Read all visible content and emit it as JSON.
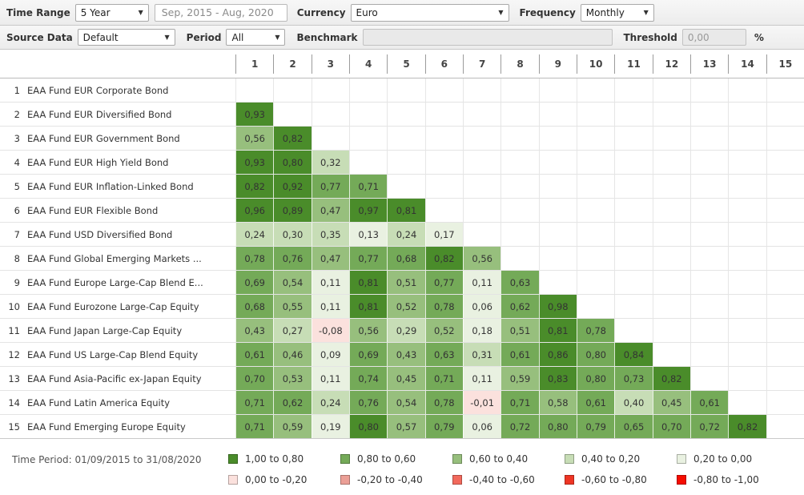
{
  "toolbar": {
    "time_range_label": "Time Range",
    "time_range_value": "5 Year",
    "date_range": "Sep, 2015 - Aug, 2020",
    "currency_label": "Currency",
    "currency_value": "Euro",
    "frequency_label": "Frequency",
    "frequency_value": "Monthly",
    "source_data_label": "Source Data",
    "source_data_value": "Default",
    "period_label": "Period",
    "period_value": "All",
    "benchmark_label": "Benchmark",
    "benchmark_value": "",
    "threshold_label": "Threshold",
    "threshold_value": "0,00",
    "threshold_unit": "%",
    "dropdown_caret": "▼"
  },
  "colors": {
    "a": "#4a8c2a",
    "b": "#74aa58",
    "c": "#97bf7d",
    "d": "#c7ddb6",
    "e": "#e9f1e1",
    "f": "#fbe1dd",
    "g": "#eb9f96",
    "h": "#f2695c",
    "i": "#ee3524",
    "j": "#f50d00"
  },
  "matrix": {
    "columns": [
      "1",
      "2",
      "3",
      "4",
      "5",
      "6",
      "7",
      "8",
      "9",
      "10",
      "11",
      "12",
      "13",
      "14",
      "15"
    ],
    "rows": [
      {
        "num": "1",
        "label": "EAA Fund EUR Corporate Bond",
        "values": [],
        "levels": []
      },
      {
        "num": "2",
        "label": "EAA Fund EUR Diversified Bond",
        "values": [
          "0,93"
        ],
        "levels": [
          "a"
        ]
      },
      {
        "num": "3",
        "label": "EAA Fund EUR Government Bond",
        "values": [
          "0,56",
          "0,82"
        ],
        "levels": [
          "c",
          "a"
        ]
      },
      {
        "num": "4",
        "label": "EAA Fund EUR High Yield Bond",
        "values": [
          "0,93",
          "0,80",
          "0,32"
        ],
        "levels": [
          "a",
          "a",
          "d"
        ]
      },
      {
        "num": "5",
        "label": "EAA Fund EUR Inflation-Linked Bond",
        "values": [
          "0,82",
          "0,92",
          "0,77",
          "0,71"
        ],
        "levels": [
          "a",
          "a",
          "b",
          "b"
        ]
      },
      {
        "num": "6",
        "label": "EAA Fund EUR Flexible Bond",
        "values": [
          "0,96",
          "0,89",
          "0,47",
          "0,97",
          "0,81"
        ],
        "levels": [
          "a",
          "a",
          "c",
          "a",
          "a"
        ]
      },
      {
        "num": "7",
        "label": "EAA Fund USD Diversified Bond",
        "values": [
          "0,24",
          "0,30",
          "0,35",
          "0,13",
          "0,24",
          "0,17"
        ],
        "levels": [
          "d",
          "d",
          "d",
          "e",
          "d",
          "e"
        ]
      },
      {
        "num": "8",
        "label": "EAA Fund Global Emerging Markets ...",
        "values": [
          "0,78",
          "0,76",
          "0,47",
          "0,77",
          "0,68",
          "0,82",
          "0,56"
        ],
        "levels": [
          "b",
          "b",
          "c",
          "b",
          "b",
          "a",
          "c"
        ]
      },
      {
        "num": "9",
        "label": "EAA Fund Europe Large-Cap Blend E...",
        "values": [
          "0,69",
          "0,54",
          "0,11",
          "0,81",
          "0,51",
          "0,77",
          "0,11",
          "0,63"
        ],
        "levels": [
          "b",
          "c",
          "e",
          "a",
          "c",
          "b",
          "e",
          "b"
        ]
      },
      {
        "num": "10",
        "label": "EAA Fund Eurozone Large-Cap Equity",
        "values": [
          "0,68",
          "0,55",
          "0,11",
          "0,81",
          "0,52",
          "0,78",
          "0,06",
          "0,62",
          "0,98"
        ],
        "levels": [
          "b",
          "c",
          "e",
          "a",
          "c",
          "b",
          "e",
          "b",
          "a"
        ]
      },
      {
        "num": "11",
        "label": "EAA Fund Japan Large-Cap Equity",
        "values": [
          "0,43",
          "0,27",
          "-0,08",
          "0,56",
          "0,29",
          "0,52",
          "0,18",
          "0,51",
          "0,81",
          "0,78"
        ],
        "levels": [
          "c",
          "d",
          "f",
          "c",
          "d",
          "c",
          "e",
          "c",
          "a",
          "b"
        ]
      },
      {
        "num": "12",
        "label": "EAA Fund US Large-Cap Blend Equity",
        "values": [
          "0,61",
          "0,46",
          "0,09",
          "0,69",
          "0,43",
          "0,63",
          "0,31",
          "0,61",
          "0,86",
          "0,80",
          "0,84"
        ],
        "levels": [
          "b",
          "c",
          "e",
          "b",
          "c",
          "b",
          "d",
          "b",
          "a",
          "b",
          "a"
        ]
      },
      {
        "num": "13",
        "label": "EAA Fund Asia-Pacific ex-Japan Equity",
        "values": [
          "0,70",
          "0,53",
          "0,11",
          "0,74",
          "0,45",
          "0,71",
          "0,11",
          "0,59",
          "0,83",
          "0,80",
          "0,73",
          "0,82"
        ],
        "levels": [
          "b",
          "c",
          "e",
          "b",
          "c",
          "b",
          "e",
          "c",
          "a",
          "b",
          "b",
          "a"
        ]
      },
      {
        "num": "14",
        "label": "EAA Fund Latin America Equity",
        "values": [
          "0,71",
          "0,62",
          "0,24",
          "0,76",
          "0,54",
          "0,78",
          "-0,01",
          "0,71",
          "0,58",
          "0,61",
          "0,40",
          "0,45",
          "0,61"
        ],
        "levels": [
          "b",
          "b",
          "d",
          "b",
          "c",
          "b",
          "f",
          "b",
          "c",
          "b",
          "d",
          "c",
          "b"
        ]
      },
      {
        "num": "15",
        "label": "EAA Fund Emerging Europe Equity",
        "values": [
          "0,71",
          "0,59",
          "0,19",
          "0,80",
          "0,57",
          "0,79",
          "0,06",
          "0,72",
          "0,80",
          "0,79",
          "0,65",
          "0,70",
          "0,72",
          "0,82"
        ],
        "levels": [
          "b",
          "c",
          "e",
          "a",
          "c",
          "b",
          "e",
          "b",
          "b",
          "b",
          "b",
          "b",
          "b",
          "a"
        ]
      }
    ]
  },
  "legend": {
    "time_period": "Time Period: 01/09/2015 to 31/08/2020",
    "items": [
      {
        "label": "1,00 to 0,80",
        "level": "a"
      },
      {
        "label": "0,80 to 0,60",
        "level": "b"
      },
      {
        "label": "0,60 to 0,40",
        "level": "c"
      },
      {
        "label": "0,40 to 0,20",
        "level": "d"
      },
      {
        "label": "0,20 to 0,00",
        "level": "e"
      },
      {
        "label": "0,00 to -0,20",
        "level": "f"
      },
      {
        "label": "-0,20 to -0,40",
        "level": "g"
      },
      {
        "label": "-0,40 to -0,60",
        "level": "h"
      },
      {
        "label": "-0,60 to -0,80",
        "level": "i"
      },
      {
        "label": "-0,80 to -1,00",
        "level": "j"
      }
    ]
  }
}
